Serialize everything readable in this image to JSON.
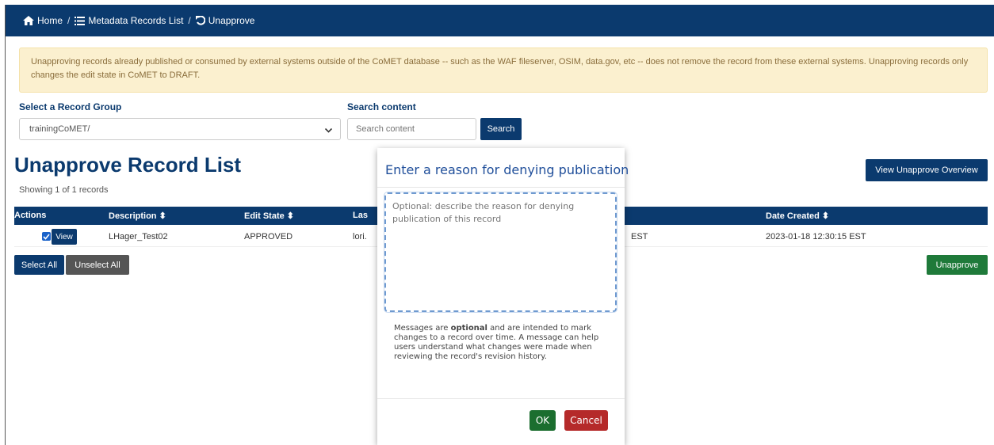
{
  "breadcrumb": {
    "home": "Home",
    "sep1": "/",
    "list": "Metadata Records List",
    "sep2": "/",
    "current": "Unapprove"
  },
  "notice": "Unapproving records already published or consumed by external systems outside of the CoMET database -- such as the WAF fileserver, OSIM, data.gov, etc -- does not remove the record from these external systems. Unapproving records only changes the edit state in CoMET to DRAFT.",
  "filters": {
    "group_label": "Select a Record Group",
    "group_value": "trainingCoMET/",
    "search_label": "Search content",
    "search_placeholder": "Search content",
    "search_button": "Search"
  },
  "page": {
    "title": "Unapprove Record List",
    "showing": "Showing 1 of 1 records",
    "overview_button": "View Unapprove Overview"
  },
  "table": {
    "headers": {
      "actions": "Actions",
      "description": "Description ⬍",
      "edit_state": "Edit State ⬍",
      "last": "Las",
      "date_created": "Date Created ⬍"
    },
    "rows": [
      {
        "view": "View",
        "description": "LHager_Test02",
        "edit_state": "APPROVED",
        "last": "lori.",
        "last_tail": "EST",
        "date_created": "2023-01-18 12:30:15 EST"
      }
    ]
  },
  "actions": {
    "select_all": "Select All",
    "unselect_all": "Unselect All",
    "unapprove": "Unapprove"
  },
  "modal": {
    "title": "Enter a reason for denying publication",
    "placeholder": "Optional: describe the reason for denying publication of this record",
    "help_pre": "Messages are ",
    "help_bold": "optional",
    "help_post": " and are intended to mark changes to a record over time. A message can help users understand what changes were made when reviewing the record's revision history.",
    "ok": "OK",
    "cancel": "Cancel"
  },
  "colors": {
    "navy": "#0b3a6e",
    "green": "#1f7a3a",
    "red": "#b52a2a",
    "notice_bg": "#fbf0cf",
    "notice_text": "#8a6d3b"
  }
}
